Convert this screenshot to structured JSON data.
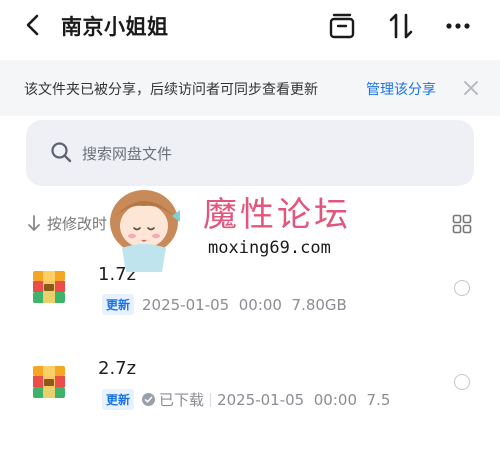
{
  "header": {
    "title": "南京小姐姐"
  },
  "notice": {
    "text": "该文件夹已被分享，后续访问者可同步查看更新",
    "link": "管理该分享"
  },
  "search": {
    "placeholder": "搜索网盘文件"
  },
  "sort": {
    "label": "按修改时"
  },
  "files": [
    {
      "name": "1.7z",
      "badge": "更新",
      "date": "2025-01-05",
      "time": "00:00",
      "size": "7.80GB"
    },
    {
      "name": "2.7z",
      "badge": "更新",
      "status": "已下载",
      "date": "2025-01-05",
      "time": "00:00",
      "size": "7.5"
    }
  ],
  "watermark": {
    "title": "魔性论坛",
    "url": "moxing69.com"
  },
  "colors": {
    "accent": "#1a73e8",
    "watermark": "#e0567c",
    "search_bg": "#eef0f6",
    "notice_bg": "#f5f6f8"
  },
  "icons": [
    "back-icon",
    "collection-icon",
    "sort-toggle-icon",
    "more-icon",
    "close-icon",
    "search-icon",
    "sort-down-icon",
    "grid-view-icon",
    "zip-file-icon",
    "downloaded-check-icon"
  ]
}
